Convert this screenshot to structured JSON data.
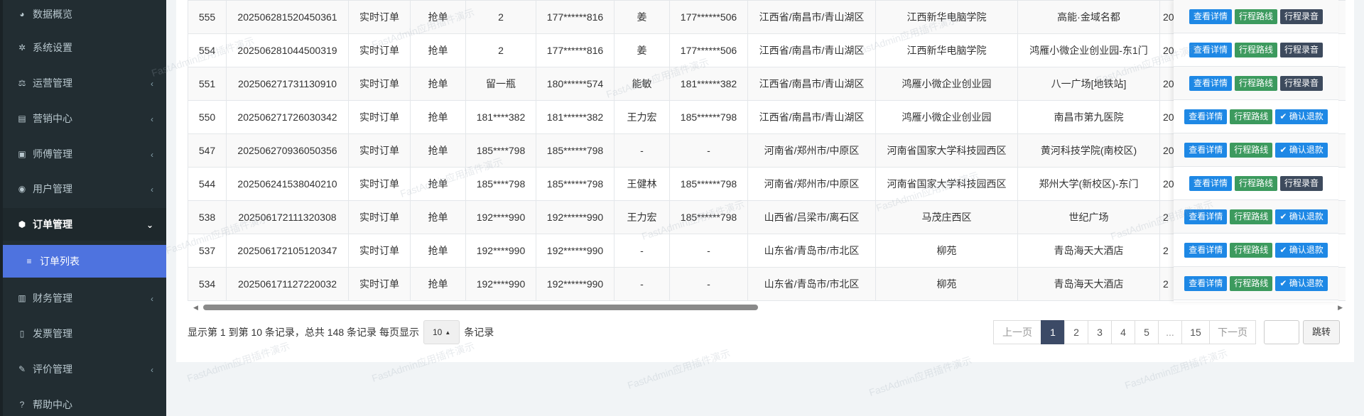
{
  "sidebar": {
    "items": [
      {
        "label": "数据概览",
        "icon": "dashboard-icon",
        "glyph": "◕",
        "arrow": ""
      },
      {
        "label": "系统设置",
        "icon": "gear-icon",
        "glyph": "✲",
        "arrow": ""
      },
      {
        "label": "运营管理",
        "icon": "balance-icon",
        "glyph": "⚖",
        "arrow": "‹"
      },
      {
        "label": "营销中心",
        "icon": "calendar-icon",
        "glyph": "▤",
        "arrow": "‹"
      },
      {
        "label": "师傅管理",
        "icon": "id-card-icon",
        "glyph": "▣",
        "arrow": "‹"
      },
      {
        "label": "用户管理",
        "icon": "user-icon",
        "glyph": "◉",
        "arrow": "‹"
      },
      {
        "label": "订单管理",
        "icon": "cube-icon",
        "glyph": "⬢",
        "arrow": "⌄"
      },
      {
        "label": "订单列表",
        "icon": "list-icon",
        "glyph": "≡",
        "arrow": ""
      },
      {
        "label": "财务管理",
        "icon": "money-icon",
        "glyph": "▥",
        "arrow": "‹"
      },
      {
        "label": "发票管理",
        "icon": "file-icon",
        "glyph": "▯",
        "arrow": ""
      },
      {
        "label": "评价管理",
        "icon": "edit-icon",
        "glyph": "✎",
        "arrow": "‹"
      },
      {
        "label": "帮助中心",
        "icon": "help-icon",
        "glyph": "?",
        "arrow": ""
      }
    ]
  },
  "table": {
    "rows": [
      {
        "id": "555",
        "order_no": "202506281520450361",
        "type": "实时订单",
        "mode": "抢单",
        "passenger": "2",
        "passenger_phone": "177******816",
        "driver": "姜",
        "driver_phone": "177******506",
        "area": "江西省/南昌市/青山湖区",
        "start": "江西新华电脑学院",
        "end": "高能·金域名都",
        "extra": "20",
        "action": "audio"
      },
      {
        "id": "554",
        "order_no": "202506281044500319",
        "type": "实时订单",
        "mode": "抢单",
        "passenger": "2",
        "passenger_phone": "177******816",
        "driver": "姜",
        "driver_phone": "177******506",
        "area": "江西省/南昌市/青山湖区",
        "start": "江西新华电脑学院",
        "end": "鸿雁小微企业创业园-东1门",
        "extra": "20",
        "action": "audio"
      },
      {
        "id": "551",
        "order_no": "202506271731130910",
        "type": "实时订单",
        "mode": "抢单",
        "passenger": "留一瓶",
        "passenger_phone": "180******574",
        "driver": "能敏",
        "driver_phone": "181******382",
        "area": "江西省/南昌市/青山湖区",
        "start": "鸿雁小微企业创业园",
        "end": "八一广场[地铁站]",
        "extra": "20",
        "action": "audio"
      },
      {
        "id": "550",
        "order_no": "202506271726030342",
        "type": "实时订单",
        "mode": "抢单",
        "passenger": "181****382",
        "passenger_phone": "181******382",
        "driver": "王力宏",
        "driver_phone": "185******798",
        "area": "江西省/南昌市/青山湖区",
        "start": "鸿雁小微企业创业园",
        "end": "南昌市第九医院",
        "extra": "20",
        "action": "refund"
      },
      {
        "id": "547",
        "order_no": "202506270936050356",
        "type": "实时订单",
        "mode": "抢单",
        "passenger": "185****798",
        "passenger_phone": "185******798",
        "driver": "-",
        "driver_phone": "-",
        "area": "河南省/郑州市/中原区",
        "start": "河南省国家大学科技园西区",
        "end": "黄河科技学院(南校区)",
        "extra": "20",
        "action": "refund"
      },
      {
        "id": "544",
        "order_no": "202506241538040210",
        "type": "实时订单",
        "mode": "抢单",
        "passenger": "185****798",
        "passenger_phone": "185******798",
        "driver": "王健林",
        "driver_phone": "185******798",
        "area": "河南省/郑州市/中原区",
        "start": "河南省国家大学科技园西区",
        "end": "郑州大学(新校区)-东门",
        "extra": "20",
        "action": "audio"
      },
      {
        "id": "538",
        "order_no": "202506172111320308",
        "type": "实时订单",
        "mode": "抢单",
        "passenger": "192****990",
        "passenger_phone": "192******990",
        "driver": "王力宏",
        "driver_phone": "185******798",
        "area": "山西省/吕梁市/离石区",
        "start": "马茂庄西区",
        "end": "世纪广场",
        "extra": "2",
        "action": "refund"
      },
      {
        "id": "537",
        "order_no": "202506172105120347",
        "type": "实时订单",
        "mode": "抢单",
        "passenger": "192****990",
        "passenger_phone": "192******990",
        "driver": "-",
        "driver_phone": "-",
        "area": "山东省/青岛市/市北区",
        "start": "柳苑",
        "end": "青岛海天大酒店",
        "extra": "2",
        "action": "refund"
      },
      {
        "id": "534",
        "order_no": "202506171127220032",
        "type": "实时订单",
        "mode": "抢单",
        "passenger": "192****990",
        "passenger_phone": "192******990",
        "driver": "-",
        "driver_phone": "-",
        "area": "山东省/青岛市/市北区",
        "start": "柳苑",
        "end": "青岛海天大酒店",
        "extra": "2",
        "action": "refund"
      }
    ],
    "buttons": {
      "detail": "查看详情",
      "route": "行程路线",
      "audio": "行程录音",
      "refund": "✔ 确认退款"
    }
  },
  "footer": {
    "info_prefix": "显示第 1 到第 10 条记录，总共 148 条记录 每页显示",
    "page_size": "10",
    "info_suffix": "条记录",
    "prev": "上一页",
    "next": "下一页",
    "pages": [
      "1",
      "2",
      "3",
      "4",
      "5",
      "...",
      "15"
    ],
    "current_page": "1",
    "jump": "跳转"
  },
  "watermark": "FastAdmin应用插件演示",
  "colors": {
    "sidebar_bg": "#222d32",
    "sidebar_active": "#4e73df",
    "btn_detail": "#1e88e5",
    "btn_route": "#3c9a5e",
    "btn_audio": "#3d4a5d",
    "pager_active": "#3c4a66"
  }
}
